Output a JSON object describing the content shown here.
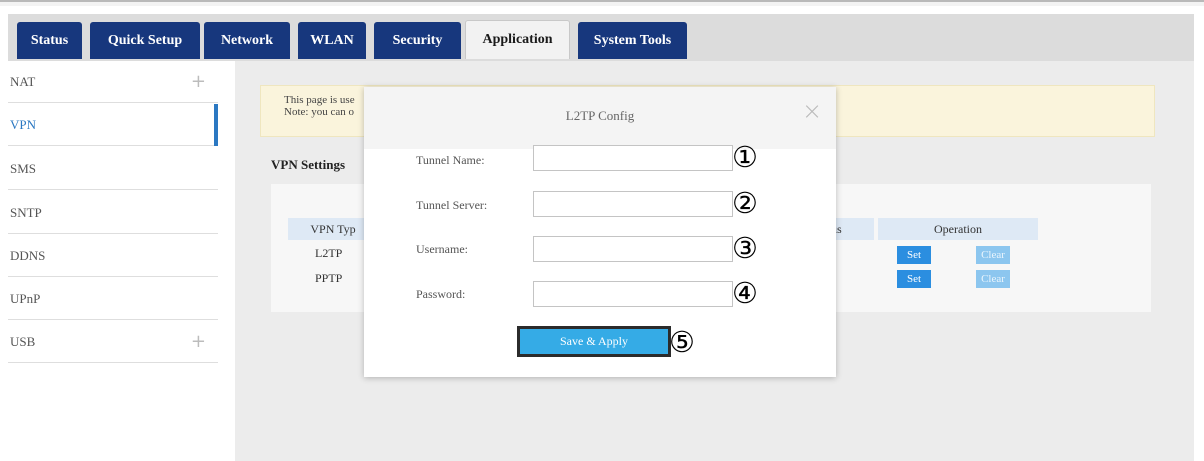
{
  "tabs": [
    {
      "label": "Status",
      "active": false
    },
    {
      "label": "Quick Setup",
      "active": false
    },
    {
      "label": "Network",
      "active": false
    },
    {
      "label": "WLAN",
      "active": false
    },
    {
      "label": "Security",
      "active": false
    },
    {
      "label": "Application",
      "active": true
    },
    {
      "label": "System Tools",
      "active": false
    }
  ],
  "sidebar": {
    "items": [
      {
        "label": "NAT",
        "expandable": true
      },
      {
        "label": "VPN",
        "active": true
      },
      {
        "label": "SMS"
      },
      {
        "label": "SNTP"
      },
      {
        "label": "DDNS"
      },
      {
        "label": "UPnP"
      },
      {
        "label": "USB",
        "expandable": true
      }
    ],
    "expand_glyph": "+"
  },
  "notice": {
    "line1": "This page is use",
    "line2": "Note: you can o"
  },
  "vpn_settings": {
    "title": "VPN Settings",
    "columns": [
      "VPN Typ",
      "us",
      "Operation"
    ],
    "rows": [
      {
        "type": "L2TP",
        "set_label": "Set",
        "clear_label": "Clear"
      },
      {
        "type": "PPTP",
        "set_label": "Set",
        "clear_label": "Clear"
      }
    ]
  },
  "modal": {
    "title": "L2TP Config",
    "close_glyph": "×",
    "fields": [
      {
        "label": "Tunnel Name:",
        "value": "",
        "marker": "①"
      },
      {
        "label": "Tunnel Server:",
        "value": "",
        "marker": "②"
      },
      {
        "label": "Username:",
        "value": "",
        "marker": "③"
      },
      {
        "label": "Password:",
        "value": "",
        "marker": "④"
      }
    ],
    "save_label": "Save & Apply",
    "save_marker": "⑤"
  },
  "colors": {
    "tab_bg": "#17377d",
    "accent_blue": "#2b78c2",
    "button_blue": "#2b8ee0",
    "save_button": "#35abe6",
    "notice_bg": "#faf4dc"
  }
}
